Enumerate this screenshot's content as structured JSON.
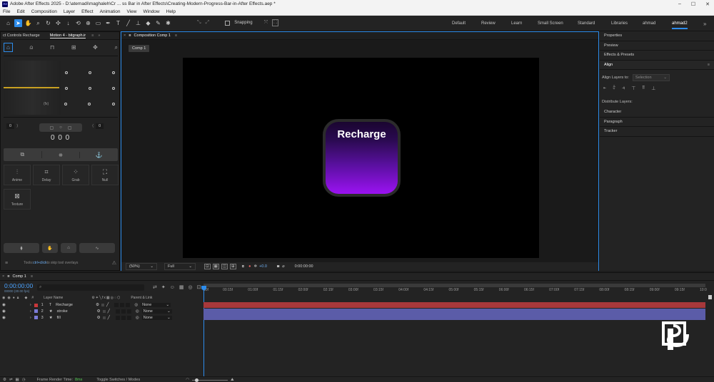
{
  "titlebar": {
    "app_icon": "Ae",
    "title": "Adobe After Effects 2025 - D:\\atemadi\\maghaleh\\Cr ... ss Bar in After Effects\\Creating-Modern-Progress-Bar-in-After Effects.aep *",
    "controls": [
      "–",
      "☐",
      "✕"
    ]
  },
  "menu": [
    "File",
    "Edit",
    "Composition",
    "Layer",
    "Effect",
    "Animation",
    "View",
    "Window",
    "Help"
  ],
  "toolbar": {
    "snapping_label": "Snapping",
    "workspaces": [
      {
        "label": "Default"
      },
      {
        "label": "Review"
      },
      {
        "label": "Learn"
      },
      {
        "label": "Small Screen"
      },
      {
        "label": "Standard"
      },
      {
        "label": "Libraries"
      },
      {
        "label": "ahmad"
      },
      {
        "label": "ahmad2"
      }
    ],
    "active_workspace": "ahmad2"
  },
  "left_panel": {
    "tab1": "ct Controls Recharge",
    "tab2": "Motion 4 - bitgraph.ir",
    "fx_label": "(fx)",
    "field_left": "0",
    "field_right": "0",
    "center_value": "0 0 0",
    "tiles": [
      {
        "label": "Anime"
      },
      {
        "label": "Delay"
      },
      {
        "label": "Grab"
      },
      {
        "label": "Null"
      },
      {
        "label": "Texture"
      }
    ],
    "hint_prefix": "Tools: ",
    "hint_key": "ctrl+click",
    "hint_suffix": " to skip tool overlays"
  },
  "composition": {
    "tab_label": "Composition Comp 1",
    "comp_chip": "Comp 1",
    "card_title": "Recharge",
    "zoom": "(50%)",
    "resolution": "Full",
    "exposure": "+0.0",
    "timecode": "0:00:00:00"
  },
  "right_panel": {
    "items": [
      "Properties",
      "Preview",
      "Effects & Presets"
    ],
    "align_title": "Align",
    "align_layers_to_label": "Align Layers to:",
    "align_layers_to_value": "Selection",
    "distribute_label": "Distribute Layers:",
    "bottom_items": [
      "Character",
      "Paragraph",
      "Tracker"
    ]
  },
  "timeline": {
    "tab_label": "Comp 1",
    "current_time": "0:00:00:00",
    "fps": "00000 (30.00 fps)",
    "search_placeholder": "",
    "col_layer_name": "Layer Name",
    "col_parent": "Parent & Link",
    "layers": [
      {
        "num": "1",
        "type": "T",
        "name": "Recharge",
        "parent": "None",
        "color": "#c9373a",
        "track": "#a8383b"
      },
      {
        "num": "2",
        "type": "★",
        "name": "stroke",
        "parent": "None",
        "color": "#7b7bd6",
        "track": "#5b5ca8"
      },
      {
        "num": "3",
        "type": "★",
        "name": "fill",
        "parent": "None",
        "color": "#7b7bd6",
        "track": "#5b5ca8"
      }
    ],
    "ruler_ticks": [
      "00f",
      "00:15f",
      "01:00f",
      "01:15f",
      "02:00f",
      "02:15f",
      "03:00f",
      "03:15f",
      "04:00f",
      "04:15f",
      "05:00f",
      "05:15f",
      "06:00f",
      "06:15f",
      "07:00f",
      "07:15f",
      "08:00f",
      "08:15f",
      "09:00f",
      "09:15f",
      "10:0"
    ],
    "render_time_label": "Frame Render Time:",
    "render_time_value": "8ms",
    "toggle_label": "Toggle Switches / Modes"
  },
  "colors": {
    "accent": "#2d8ceb",
    "card_gradient_top": "#1a0530",
    "card_gradient_bottom": "#9b12f2",
    "layer_red": "#c9373a",
    "layer_blue": "#7b7bd6"
  }
}
